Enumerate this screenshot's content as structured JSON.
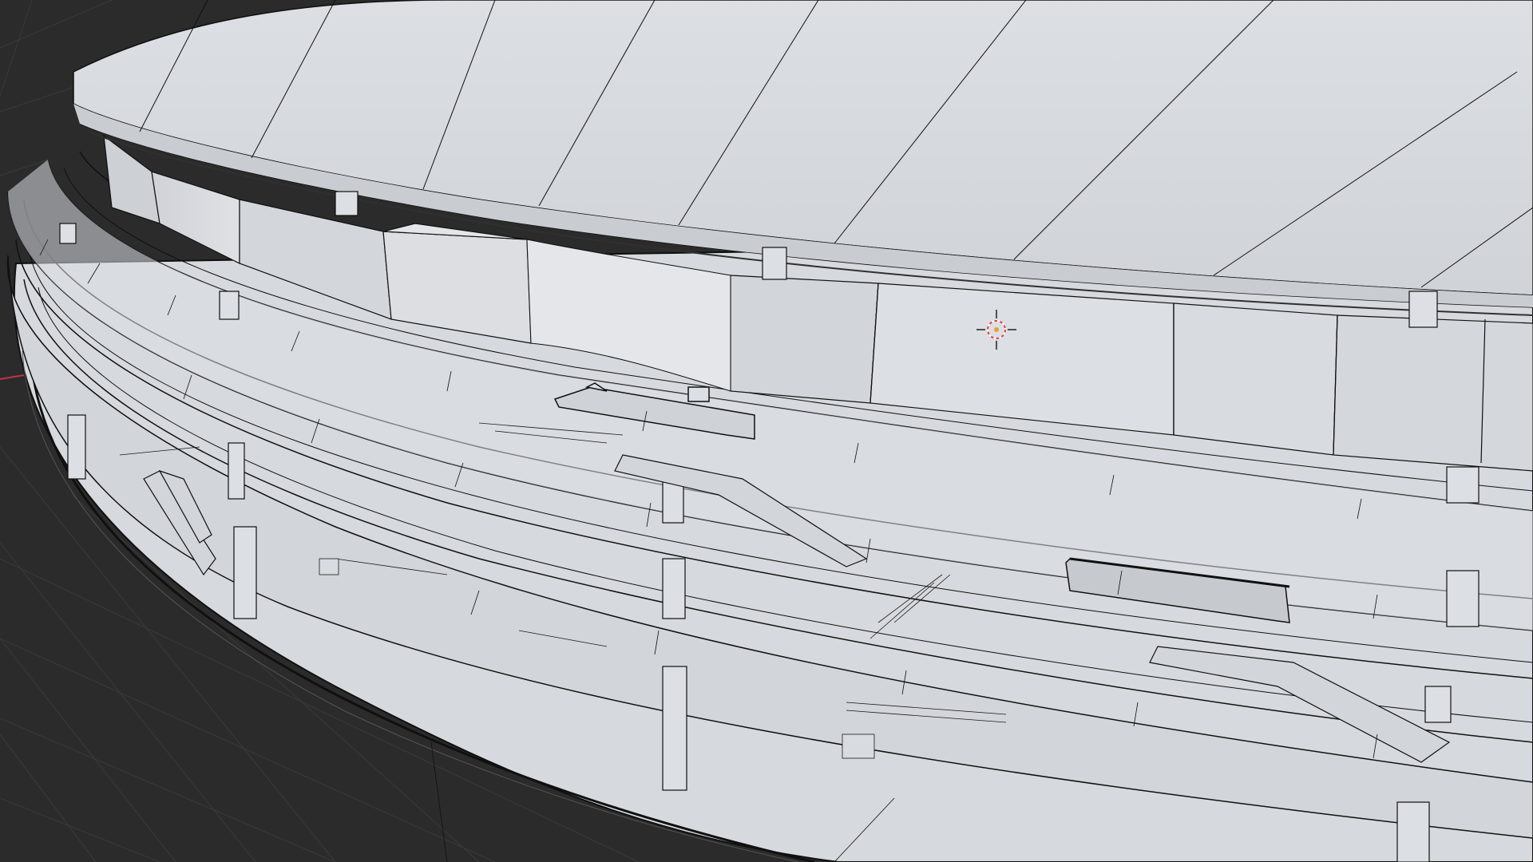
{
  "viewport": {
    "name": "3d-viewport",
    "mode": "solid-shading-with-wireframe",
    "background_color": "#2b2b2b",
    "grid_line_color": "#3a3a3a",
    "model_color": "#d9dbdf",
    "model_dark_color": "#c4c7cc",
    "edge_color": "#101010",
    "x_axis_color": "#c0334b"
  },
  "scene": {
    "object": "circular-building-model",
    "cursor": "3d-cursor-icon"
  }
}
